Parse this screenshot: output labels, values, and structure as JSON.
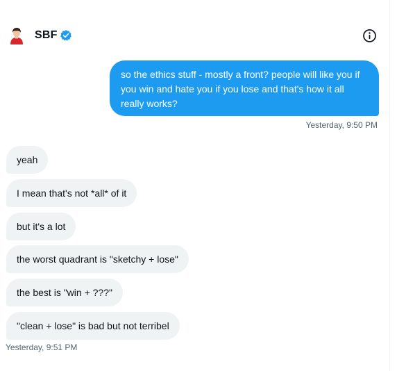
{
  "header": {
    "name": "SBF",
    "avatar_icon": "avatar-illustration-icon",
    "verified_icon": "verified-badge-icon",
    "info_icon": "info-icon",
    "accent": "#1d9bf0"
  },
  "outgoing": {
    "text": "so the ethics stuff - mostly a front? people will like you if you win and hate you if you lose and that's how it all really works?",
    "timestamp": "Yesterday, 9:50 PM",
    "color": "#1d9bf0"
  },
  "incoming": {
    "messages": [
      "yeah",
      "I mean that's not *all* of it",
      "but it's a lot",
      "the worst quadrant is \"sketchy + lose\"",
      "the best is \"win + ???\"",
      "\"clean + lose\" is bad but not terribel"
    ],
    "timestamp": "Yesterday, 9:51 PM",
    "color": "#eff3f4"
  }
}
